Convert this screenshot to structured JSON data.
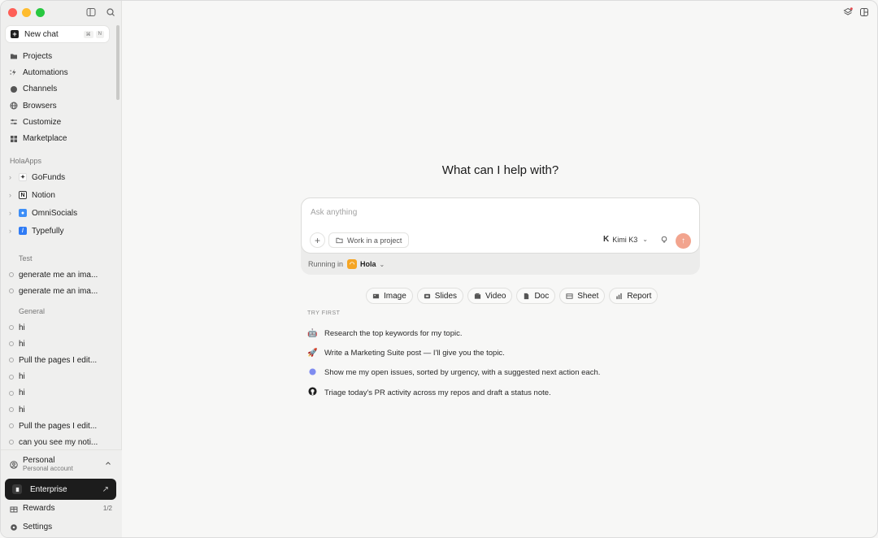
{
  "sidebar": {
    "new_chat": {
      "label": "New chat",
      "shortcut": [
        "⌘",
        "N"
      ]
    },
    "nav": [
      {
        "label": "Projects",
        "icon": "folder-icon"
      },
      {
        "label": "Automations",
        "icon": "automation-icon"
      },
      {
        "label": "Channels",
        "icon": "chat-bubble-icon"
      },
      {
        "label": "Browsers",
        "icon": "globe-icon"
      },
      {
        "label": "Customize",
        "icon": "sliders-icon"
      },
      {
        "label": "Marketplace",
        "icon": "grid-icon"
      }
    ],
    "apps_section": "HolaApps",
    "apps": [
      {
        "label": "GoFunds",
        "icon": "gofunds-icon"
      },
      {
        "label": "Notion",
        "icon": "notion-icon"
      },
      {
        "label": "OmniSocials",
        "icon": "omnisocials-icon"
      },
      {
        "label": "Typefully",
        "icon": "typefully-icon"
      }
    ],
    "test_section": "Test",
    "test_chats": [
      "generate me an ima...",
      "generate me an ima..."
    ],
    "general_section": "General",
    "general_chats": [
      "hi",
      "hi",
      "Pull the pages I edit...",
      "hi",
      "hi",
      "hi",
      "Pull the pages I edit...",
      "can you see my noti..."
    ],
    "account": {
      "name": "Personal",
      "sub": "Personal account"
    },
    "enterprise": "Enterprise",
    "rewards": {
      "label": "Rewards",
      "count": "1/2"
    },
    "settings": "Settings"
  },
  "main": {
    "headline": "What can I help with?",
    "composer": {
      "placeholder": "Ask anything",
      "project_button": "Work in a project",
      "model": "Kimi K3",
      "running_label": "Running in",
      "running_target": "Hola"
    },
    "chips": [
      {
        "label": "Image",
        "icon": "image-icon"
      },
      {
        "label": "Slides",
        "icon": "slides-icon"
      },
      {
        "label": "Video",
        "icon": "video-icon"
      },
      {
        "label": "Doc",
        "icon": "doc-icon"
      },
      {
        "label": "Sheet",
        "icon": "sheet-icon"
      },
      {
        "label": "Report",
        "icon": "report-icon"
      }
    ],
    "try_first": "TRY FIRST",
    "suggestions": [
      {
        "text": "Research the top keywords for my topic.",
        "icon": "robot-icon"
      },
      {
        "text": "Write a Marketing Suite post — I'll give you the topic.",
        "icon": "rocket-icon"
      },
      {
        "text": "Show me my open issues, sorted by urgency, with a suggested next action each.",
        "icon": "linear-icon"
      },
      {
        "text": "Triage today's PR activity across my repos and draft a status note.",
        "icon": "github-icon"
      }
    ]
  },
  "colors": {
    "send": "#f2a48e",
    "hola": "#f5a524",
    "enterprise_bg": "#1c1c1c"
  }
}
